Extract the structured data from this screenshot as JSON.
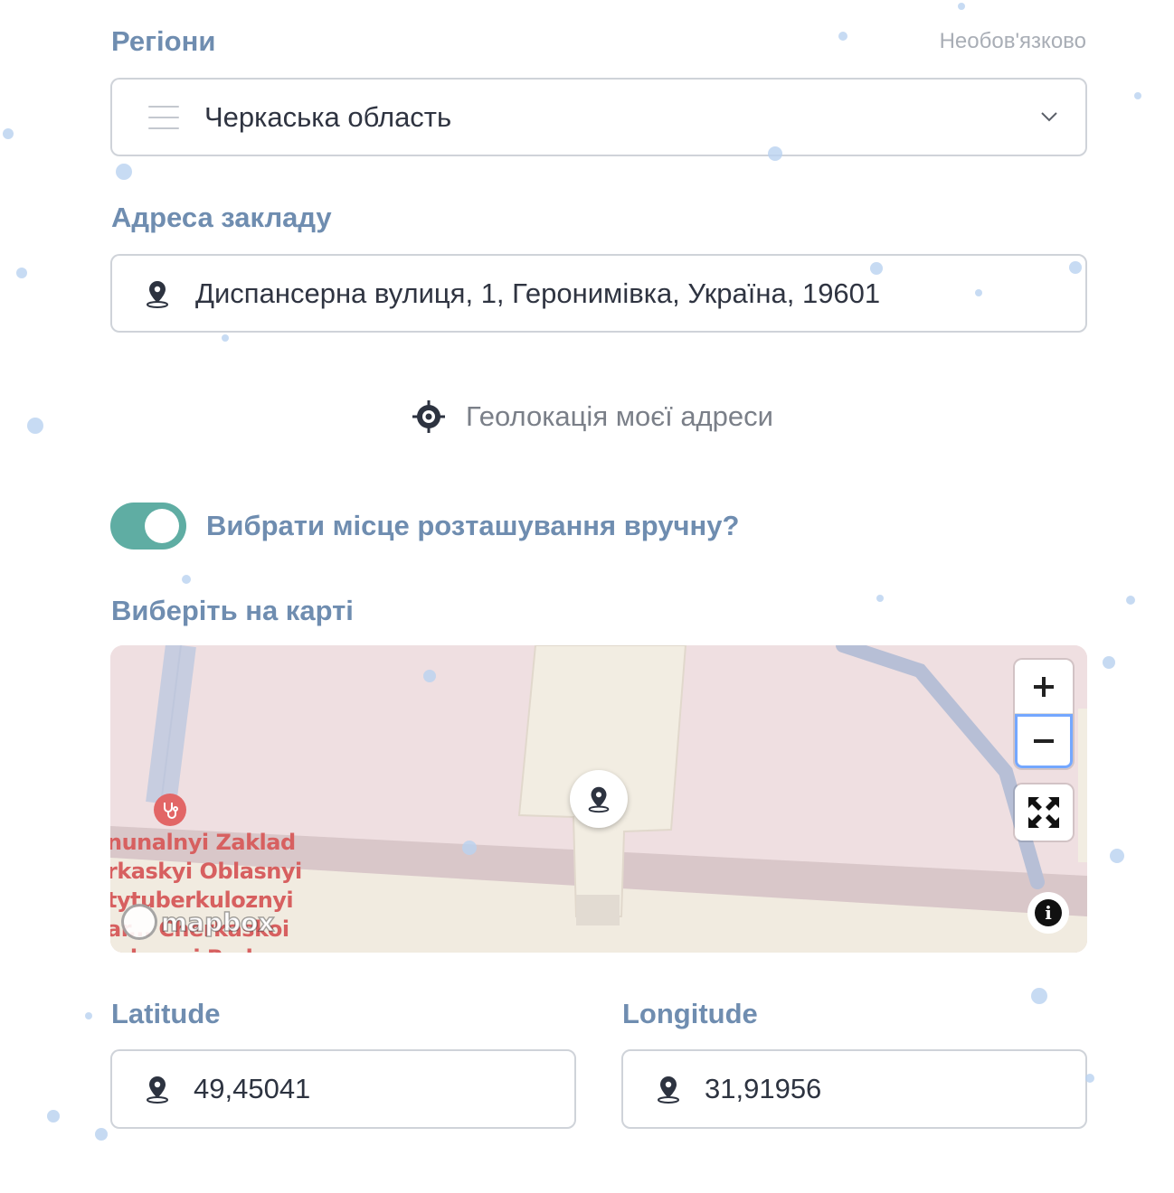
{
  "regions": {
    "label": "Регіони",
    "optional": "Необов'язково",
    "selected": "Черкаська область"
  },
  "address": {
    "label": "Адреса закладу",
    "value": "Диспансерна вулиця, 1, Геронимівка, Україна, 19601"
  },
  "geolocation": {
    "label": "Геолокація моєї адреси"
  },
  "manual": {
    "label": "Вибрати місце розташування вручну?",
    "enabled": true,
    "accent": "#5fada3"
  },
  "map": {
    "label": "Виберіть на карті",
    "poi_lines": [
      "nunalnyi Zaklad",
      "rkaskyi Oblasnyi",
      "tytuberkuloznyi",
      "ar... Cherkaskoi",
      "...loosoi Rada"
    ],
    "attribution": "mapbox",
    "zoom_in": "+",
    "zoom_out": "−",
    "info": "i"
  },
  "latitude": {
    "label": "Latitude",
    "value": "49,45041"
  },
  "longitude": {
    "label": "Longitude",
    "value": "31,91956"
  },
  "colors": {
    "label": "#6f8db0",
    "border": "#cfd3d9",
    "map_bg": "#efdfe1"
  }
}
